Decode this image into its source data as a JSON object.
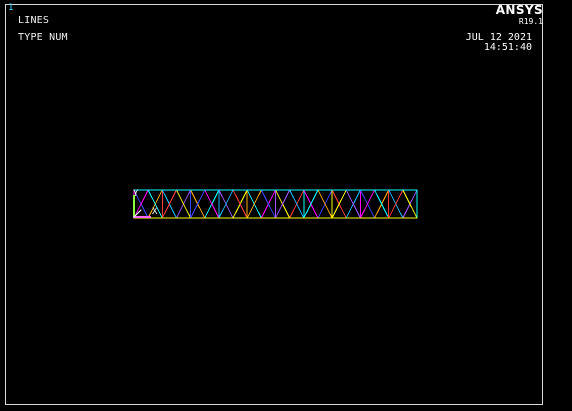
{
  "window": {
    "number": "1",
    "plot_label": "LINES",
    "type_label": "TYPE NUM"
  },
  "brand": {
    "name": "ANSYS",
    "version": "R19.1"
  },
  "timestamp": {
    "date": "JUL 12 2021",
    "time": "14:51:40"
  },
  "triad": {
    "y_label": "Y",
    "x_label": "X"
  },
  "colors": {
    "background": "#000000",
    "frame": "#d8d8d8",
    "label": "#f2f2f2",
    "window_number": "#44d9ff",
    "line_palette": [
      "#00ffff",
      "#ffff00",
      "#ff00ff",
      "#ff3b3b",
      "#3b46ff",
      "#1ab7ff",
      "#ffaa00",
      "#9f53ff"
    ]
  },
  "model": {
    "panel_count": 10
  }
}
